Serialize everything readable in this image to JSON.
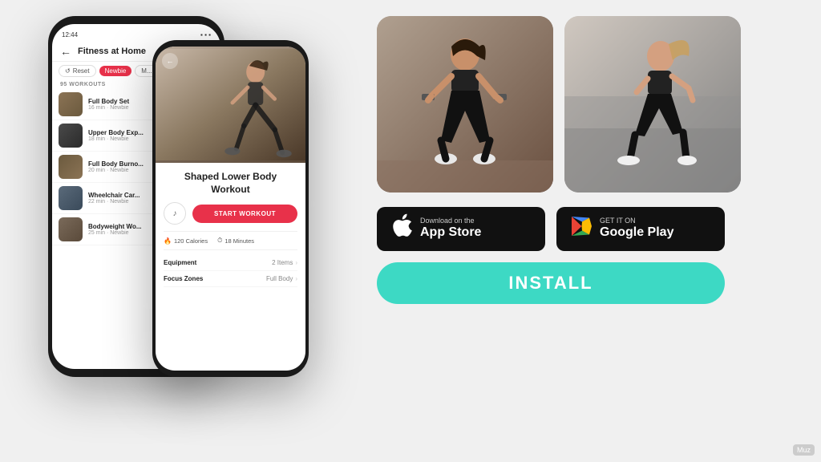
{
  "app": {
    "title": "Fitness at Home",
    "back_label": "←",
    "filter_reset": "Reset",
    "filter_newbie": "Newbie",
    "filter_more": "M...",
    "workouts_count": "95 WORKOUTS",
    "workout_list": [
      {
        "name": "Full Body Set",
        "meta": "16 min · Newbie"
      },
      {
        "name": "Upper Body Exp...",
        "meta": "18 min · Newbie"
      },
      {
        "name": "Full Body Burno...",
        "meta": "20 min · Newbie"
      },
      {
        "name": "Wheelchair Car...",
        "meta": "22 min · Newbie"
      },
      {
        "name": "Bodyweight Wo...",
        "meta": "25 min · Newbie"
      }
    ]
  },
  "detail": {
    "workout_name": "Shaped Lower Body Workout",
    "back_label": "←",
    "start_label": "START WORKOUT",
    "calories": "120 Calories",
    "minutes": "18 Minutes",
    "equipment_label": "Equipment",
    "equipment_value": "2 Items",
    "focus_label": "Focus Zones",
    "focus_value": "Full Body"
  },
  "store": {
    "apple_sub": "Download on the",
    "apple_name": "App Store",
    "google_sub": "GET IT ON",
    "google_name": "Google Play"
  },
  "install": {
    "label": "INSTALL"
  },
  "watermark": {
    "text": "Muz"
  }
}
